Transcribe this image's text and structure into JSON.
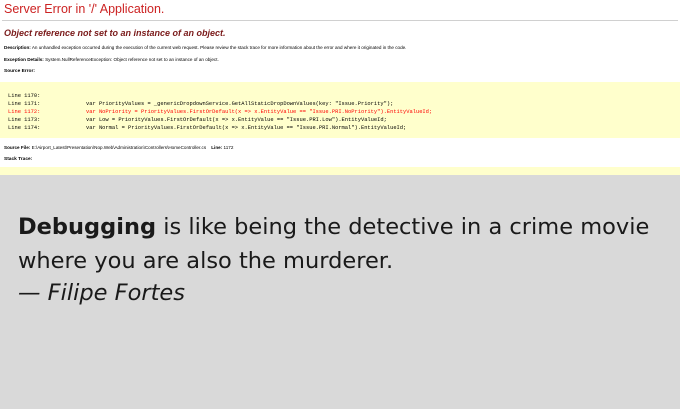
{
  "error_page": {
    "title": "Server Error in '/' Application.",
    "message": "Object reference not set to an instance of an object.",
    "description_label": "Description:",
    "description_text": "An unhandled exception occurred during the execution of the current web request. Please review the stack trace for more information about the error and where it originated in the code.",
    "exception_label": "Exception Details:",
    "exception_text": "System.NullReferenceException: Object reference not set to an instance of an object.",
    "source_error_label": "Source Error:",
    "source_lines": [
      {
        "line": "Line 1170:",
        "code": "",
        "highlight": false
      },
      {
        "line": "Line 1171:",
        "code": "var PriorityValues = _genericDropdownService.GetAllStaticDropDownValues(key: \"Issue.Priority\");",
        "highlight": false
      },
      {
        "line": "Line 1172:",
        "code": "var NoPriority = PriorityValues.FirstOrDefault(x => x.EntityValue == \"Issue.PRI.NoPriority\").EntityValueId;",
        "highlight": true
      },
      {
        "line": "Line 1173:",
        "code": "var Low = PriorityValues.FirstOrDefault(x => x.EntityValue == \"Issue.PRI.Low\").EntityValueId;",
        "highlight": false
      },
      {
        "line": "Line 1174:",
        "code": "var Normal = PriorityValues.FirstOrDefault(x => x.EntityValue == \"Issue.PRI.Normal\").EntityValueId;",
        "highlight": false
      }
    ],
    "source_file_label": "Source File:",
    "source_file_path": "E:\\Airport_Latest\\Presentation\\Nop.Web\\Administration\\Controllers\\HomeController.cs",
    "line_label": "Line:",
    "line_number": "1172",
    "stack_trace_label": "Stack Trace:"
  },
  "quote": {
    "lead": "Debugging",
    "rest": " is like being the detective in a crime movie where you are also the murderer.",
    "author": "— Filipe Fortes"
  },
  "colors": {
    "title_red": "#cc2222",
    "message_maroon": "#7a1a1a",
    "code_background": "#ffffcc",
    "highlight_red": "#ff0000",
    "quote_background": "#d9d9d9"
  }
}
